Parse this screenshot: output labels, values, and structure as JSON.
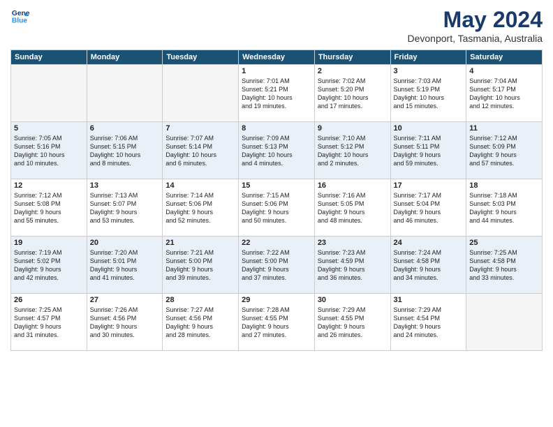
{
  "logo": {
    "line1": "General",
    "line2": "Blue"
  },
  "title": "May 2024",
  "location": "Devonport, Tasmania, Australia",
  "weekdays": [
    "Sunday",
    "Monday",
    "Tuesday",
    "Wednesday",
    "Thursday",
    "Friday",
    "Saturday"
  ],
  "weeks": [
    [
      {
        "day": "",
        "content": ""
      },
      {
        "day": "",
        "content": ""
      },
      {
        "day": "",
        "content": ""
      },
      {
        "day": "1",
        "content": "Sunrise: 7:01 AM\nSunset: 5:21 PM\nDaylight: 10 hours\nand 19 minutes."
      },
      {
        "day": "2",
        "content": "Sunrise: 7:02 AM\nSunset: 5:20 PM\nDaylight: 10 hours\nand 17 minutes."
      },
      {
        "day": "3",
        "content": "Sunrise: 7:03 AM\nSunset: 5:19 PM\nDaylight: 10 hours\nand 15 minutes."
      },
      {
        "day": "4",
        "content": "Sunrise: 7:04 AM\nSunset: 5:17 PM\nDaylight: 10 hours\nand 12 minutes."
      }
    ],
    [
      {
        "day": "5",
        "content": "Sunrise: 7:05 AM\nSunset: 5:16 PM\nDaylight: 10 hours\nand 10 minutes."
      },
      {
        "day": "6",
        "content": "Sunrise: 7:06 AM\nSunset: 5:15 PM\nDaylight: 10 hours\nand 8 minutes."
      },
      {
        "day": "7",
        "content": "Sunrise: 7:07 AM\nSunset: 5:14 PM\nDaylight: 10 hours\nand 6 minutes."
      },
      {
        "day": "8",
        "content": "Sunrise: 7:09 AM\nSunset: 5:13 PM\nDaylight: 10 hours\nand 4 minutes."
      },
      {
        "day": "9",
        "content": "Sunrise: 7:10 AM\nSunset: 5:12 PM\nDaylight: 10 hours\nand 2 minutes."
      },
      {
        "day": "10",
        "content": "Sunrise: 7:11 AM\nSunset: 5:11 PM\nDaylight: 9 hours\nand 59 minutes."
      },
      {
        "day": "11",
        "content": "Sunrise: 7:12 AM\nSunset: 5:09 PM\nDaylight: 9 hours\nand 57 minutes."
      }
    ],
    [
      {
        "day": "12",
        "content": "Sunrise: 7:12 AM\nSunset: 5:08 PM\nDaylight: 9 hours\nand 55 minutes."
      },
      {
        "day": "13",
        "content": "Sunrise: 7:13 AM\nSunset: 5:07 PM\nDaylight: 9 hours\nand 53 minutes."
      },
      {
        "day": "14",
        "content": "Sunrise: 7:14 AM\nSunset: 5:06 PM\nDaylight: 9 hours\nand 52 minutes."
      },
      {
        "day": "15",
        "content": "Sunrise: 7:15 AM\nSunset: 5:06 PM\nDaylight: 9 hours\nand 50 minutes."
      },
      {
        "day": "16",
        "content": "Sunrise: 7:16 AM\nSunset: 5:05 PM\nDaylight: 9 hours\nand 48 minutes."
      },
      {
        "day": "17",
        "content": "Sunrise: 7:17 AM\nSunset: 5:04 PM\nDaylight: 9 hours\nand 46 minutes."
      },
      {
        "day": "18",
        "content": "Sunrise: 7:18 AM\nSunset: 5:03 PM\nDaylight: 9 hours\nand 44 minutes."
      }
    ],
    [
      {
        "day": "19",
        "content": "Sunrise: 7:19 AM\nSunset: 5:02 PM\nDaylight: 9 hours\nand 42 minutes."
      },
      {
        "day": "20",
        "content": "Sunrise: 7:20 AM\nSunset: 5:01 PM\nDaylight: 9 hours\nand 41 minutes."
      },
      {
        "day": "21",
        "content": "Sunrise: 7:21 AM\nSunset: 5:00 PM\nDaylight: 9 hours\nand 39 minutes."
      },
      {
        "day": "22",
        "content": "Sunrise: 7:22 AM\nSunset: 5:00 PM\nDaylight: 9 hours\nand 37 minutes."
      },
      {
        "day": "23",
        "content": "Sunrise: 7:23 AM\nSunset: 4:59 PM\nDaylight: 9 hours\nand 36 minutes."
      },
      {
        "day": "24",
        "content": "Sunrise: 7:24 AM\nSunset: 4:58 PM\nDaylight: 9 hours\nand 34 minutes."
      },
      {
        "day": "25",
        "content": "Sunrise: 7:25 AM\nSunset: 4:58 PM\nDaylight: 9 hours\nand 33 minutes."
      }
    ],
    [
      {
        "day": "26",
        "content": "Sunrise: 7:25 AM\nSunset: 4:57 PM\nDaylight: 9 hours\nand 31 minutes."
      },
      {
        "day": "27",
        "content": "Sunrise: 7:26 AM\nSunset: 4:56 PM\nDaylight: 9 hours\nand 30 minutes."
      },
      {
        "day": "28",
        "content": "Sunrise: 7:27 AM\nSunset: 4:56 PM\nDaylight: 9 hours\nand 28 minutes."
      },
      {
        "day": "29",
        "content": "Sunrise: 7:28 AM\nSunset: 4:55 PM\nDaylight: 9 hours\nand 27 minutes."
      },
      {
        "day": "30",
        "content": "Sunrise: 7:29 AM\nSunset: 4:55 PM\nDaylight: 9 hours\nand 26 minutes."
      },
      {
        "day": "31",
        "content": "Sunrise: 7:29 AM\nSunset: 4:54 PM\nDaylight: 9 hours\nand 24 minutes."
      },
      {
        "day": "",
        "content": ""
      }
    ]
  ]
}
